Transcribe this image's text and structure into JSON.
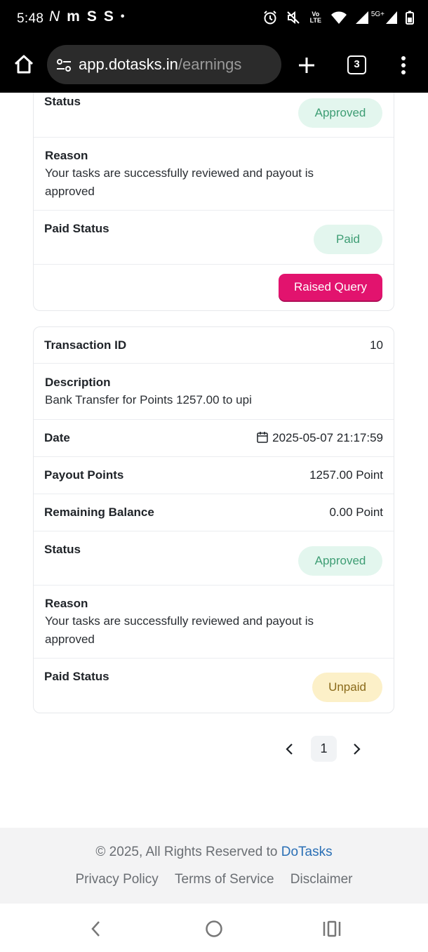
{
  "status_bar": {
    "time": "5:48",
    "left_icons": [
      "N",
      "m",
      "S",
      "S",
      "•"
    ],
    "network_label": "5G+",
    "volte_label": "Vo LTE"
  },
  "browser": {
    "url_host": "app.dotasks.in",
    "url_path": "/earnings",
    "tab_count": "3"
  },
  "card1": {
    "status_label": "Status",
    "status_value": "Approved",
    "reason_label": "Reason",
    "reason_text": "Your tasks are successfully reviewed and payout is approved",
    "paid_status_label": "Paid Status",
    "paid_status_value": "Paid",
    "query_button": "Raised Query"
  },
  "card2": {
    "txn_label": "Transaction ID",
    "txn_value": "10",
    "desc_label": "Description",
    "desc_text": "Bank Transfer for Points 1257.00 to upi",
    "date_label": "Date",
    "date_value": "2025-05-07 21:17:59",
    "payout_label": "Payout Points",
    "payout_value": "1257.00 Point",
    "balance_label": "Remaining Balance",
    "balance_value": "0.00 Point",
    "status_label": "Status",
    "status_value": "Approved",
    "reason_label": "Reason",
    "reason_text": "Your tasks are successfully reviewed and payout is approved",
    "paid_status_label": "Paid Status",
    "paid_status_value": "Unpaid"
  },
  "pagination": {
    "current_page": "1"
  },
  "footer": {
    "copyright_prefix": "© 2025, All Rights Reserved to ",
    "brand": "DoTasks",
    "links": [
      "Privacy Policy",
      "Terms of Service",
      "Disclaimer"
    ]
  },
  "colors": {
    "accent_pink": "#e2136e",
    "approved_bg": "#e3f6ee",
    "approved_text": "#3e9d74",
    "unpaid_bg": "#fcf0c8",
    "link_blue": "#2a6fb5"
  }
}
